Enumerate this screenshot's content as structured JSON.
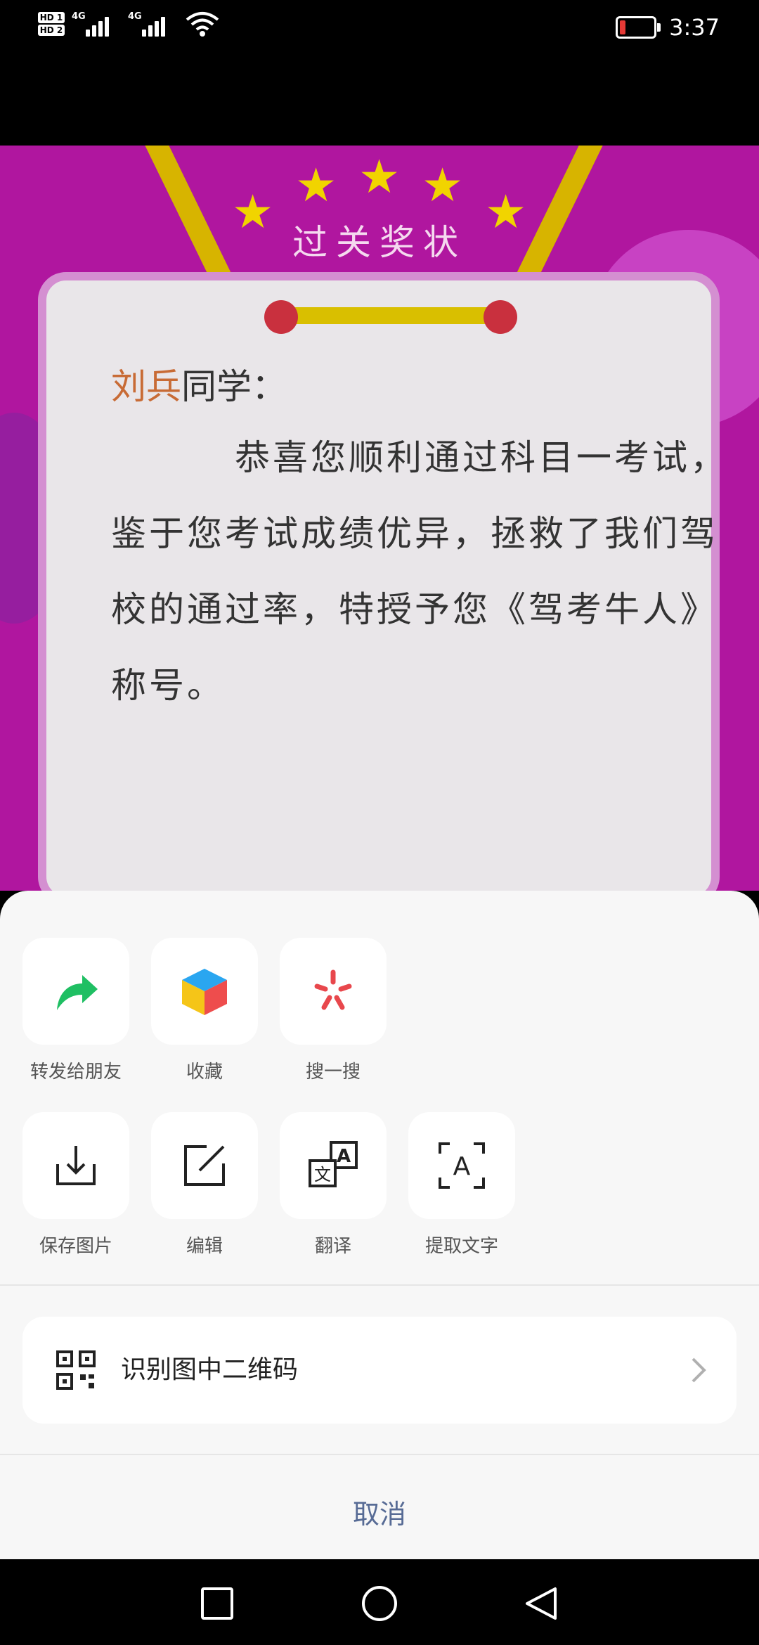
{
  "status_bar": {
    "sim1": "HD 1",
    "sim2": "HD 2",
    "network1": "4G",
    "network2": "4G",
    "time": "3:37",
    "battery_color": "#e53935"
  },
  "background": {
    "award_title": "过关奖状",
    "recipient_name": "刘兵",
    "greeting_suffix": "同学：",
    "body_text": "恭喜您顺利通过科目一考试，鉴于您考试成绩优异，拯救了我们驾校的通过率，特授予您《驾考牛人》称号。"
  },
  "sheet": {
    "row1": [
      {
        "label": "转发给朋友",
        "icon": "forward-arrow-icon"
      },
      {
        "label": "收藏",
        "icon": "favorite-cube-icon"
      },
      {
        "label": "搜一搜",
        "icon": "search-spark-icon"
      }
    ],
    "row2": [
      {
        "label": "保存图片",
        "icon": "download-icon"
      },
      {
        "label": "编辑",
        "icon": "edit-icon"
      },
      {
        "label": "翻译",
        "icon": "translate-icon"
      },
      {
        "label": "提取文字",
        "icon": "text-extract-icon"
      }
    ],
    "qr_label": "识别图中二维码",
    "cancel_label": "取消",
    "accent_color": "#576b95"
  }
}
